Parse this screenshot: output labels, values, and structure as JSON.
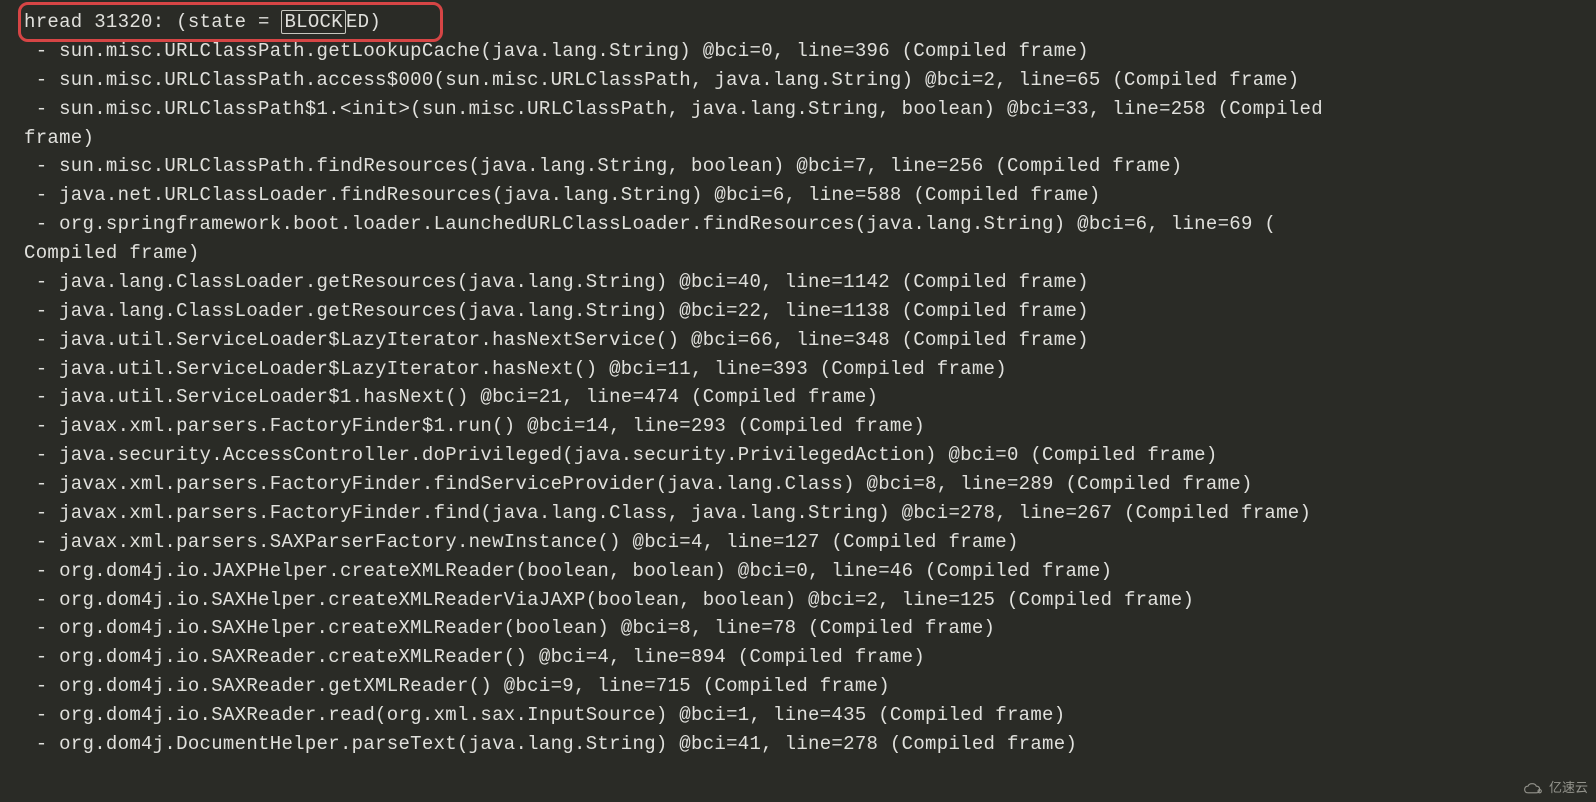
{
  "thread_header": {
    "prefix": "hread 31320: (state = ",
    "state": "BLOCK",
    "state_suffix": "ED)"
  },
  "stack_frames": [
    " - sun.misc.URLClassPath.getLookupCache(java.lang.String) @bci=0, line=396 (Compiled frame)",
    " - sun.misc.URLClassPath.access$000(sun.misc.URLClassPath, java.lang.String) @bci=2, line=65 (Compiled frame)",
    " - sun.misc.URLClassPath$1.<init>(sun.misc.URLClassPath, java.lang.String, boolean) @bci=33, line=258 (Compiled",
    "frame)",
    " - sun.misc.URLClassPath.findResources(java.lang.String, boolean) @bci=7, line=256 (Compiled frame)",
    " - java.net.URLClassLoader.findResources(java.lang.String) @bci=6, line=588 (Compiled frame)",
    " - org.springframework.boot.loader.LaunchedURLClassLoader.findResources(java.lang.String) @bci=6, line=69 (",
    "Compiled frame)",
    " - java.lang.ClassLoader.getResources(java.lang.String) @bci=40, line=1142 (Compiled frame)",
    " - java.lang.ClassLoader.getResources(java.lang.String) @bci=22, line=1138 (Compiled frame)",
    " - java.util.ServiceLoader$LazyIterator.hasNextService() @bci=66, line=348 (Compiled frame)",
    " - java.util.ServiceLoader$LazyIterator.hasNext() @bci=11, line=393 (Compiled frame)",
    " - java.util.ServiceLoader$1.hasNext() @bci=21, line=474 (Compiled frame)",
    " - javax.xml.parsers.FactoryFinder$1.run() @bci=14, line=293 (Compiled frame)",
    " - java.security.AccessController.doPrivileged(java.security.PrivilegedAction) @bci=0 (Compiled frame)",
    " - javax.xml.parsers.FactoryFinder.findServiceProvider(java.lang.Class) @bci=8, line=289 (Compiled frame)",
    " - javax.xml.parsers.FactoryFinder.find(java.lang.Class, java.lang.String) @bci=278, line=267 (Compiled frame)",
    " - javax.xml.parsers.SAXParserFactory.newInstance() @bci=4, line=127 (Compiled frame)",
    " - org.dom4j.io.JAXPHelper.createXMLReader(boolean, boolean) @bci=0, line=46 (Compiled frame)",
    " - org.dom4j.io.SAXHelper.createXMLReaderViaJAXP(boolean, boolean) @bci=2, line=125 (Compiled frame)",
    " - org.dom4j.io.SAXHelper.createXMLReader(boolean) @bci=8, line=78 (Compiled frame)",
    " - org.dom4j.io.SAXReader.createXMLReader() @bci=4, line=894 (Compiled frame)",
    " - org.dom4j.io.SAXReader.getXMLReader() @bci=9, line=715 (Compiled frame)",
    " - org.dom4j.io.SAXReader.read(org.xml.sax.InputSource) @bci=1, line=435 (Compiled frame)",
    " - org.dom4j.DocumentHelper.parseText(java.lang.String) @bci=41, line=278 (Compiled frame)"
  ],
  "watermark": {
    "text": "亿速云"
  }
}
